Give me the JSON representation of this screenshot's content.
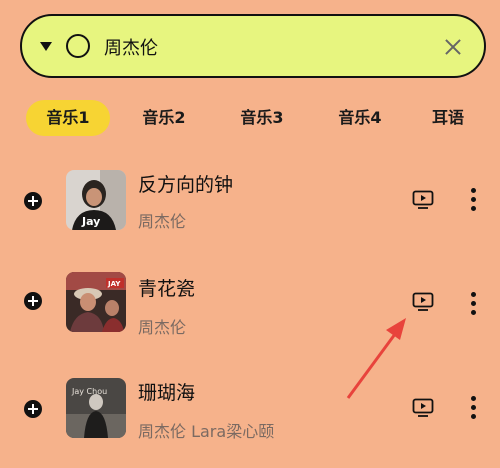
{
  "search": {
    "value": "周杰伦",
    "icons": {
      "dropdown": "caret-down-icon",
      "leading": "circle-icon",
      "clear": "close-icon"
    }
  },
  "tabs": [
    {
      "label": "音乐1",
      "active": true
    },
    {
      "label": "音乐2",
      "active": false
    },
    {
      "label": "音乐3",
      "active": false
    },
    {
      "label": "音乐4",
      "active": false
    },
    {
      "label": "耳语",
      "active": false
    }
  ],
  "songs": [
    {
      "title": "反方向的钟",
      "artist": "周杰伦",
      "cover_text": "Jay"
    },
    {
      "title": "青花瓷",
      "artist": "周杰伦",
      "cover_text": "JAY"
    },
    {
      "title": "珊瑚海",
      "artist": "周杰伦 Lara梁心颐",
      "cover_text": "Jay Chou"
    }
  ],
  "colors": {
    "background": "#f6b28b",
    "search_bg": "#e7f57f",
    "active_tab": "#f7d433",
    "annotation_arrow": "#e8433c"
  }
}
